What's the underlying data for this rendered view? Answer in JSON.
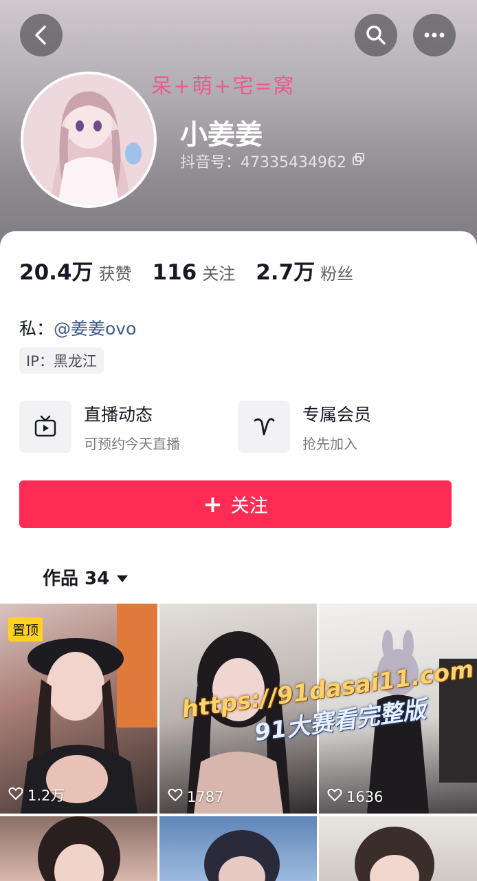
{
  "header": {
    "slogan": "呆+萌+宅=窝",
    "nickname": "小姜姜",
    "douyin_id": "抖音号：47335434962"
  },
  "stats": [
    {
      "value": "20.4万",
      "label": "获赞"
    },
    {
      "value": "116",
      "label": "关注"
    },
    {
      "value": "2.7万",
      "label": "粉丝"
    }
  ],
  "bio": {
    "private_label": "私：",
    "private_link": "@姜姜ovo",
    "ip": "IP：黑龙江"
  },
  "features": [
    {
      "title": "直播动态",
      "subtitle": "可预约今天直播",
      "icon": "tv-icon"
    },
    {
      "title": "专属会员",
      "subtitle": "抢先加入",
      "icon": "heart-v-icon"
    }
  ],
  "follow_button": {
    "plus": "+",
    "label": "关注"
  },
  "works_tab": {
    "label": "作品 34"
  },
  "videos": [
    {
      "pinned": "置顶",
      "likes": "1.2万"
    },
    {
      "likes": "1787"
    },
    {
      "likes": "1636"
    }
  ],
  "watermark": {
    "line1": "https://91dasai11.com",
    "line2": "91大赛看完整版"
  },
  "colors": {
    "accent": "#fe2c55",
    "pin": "#ffd21f",
    "link": "#3c5a8a"
  }
}
